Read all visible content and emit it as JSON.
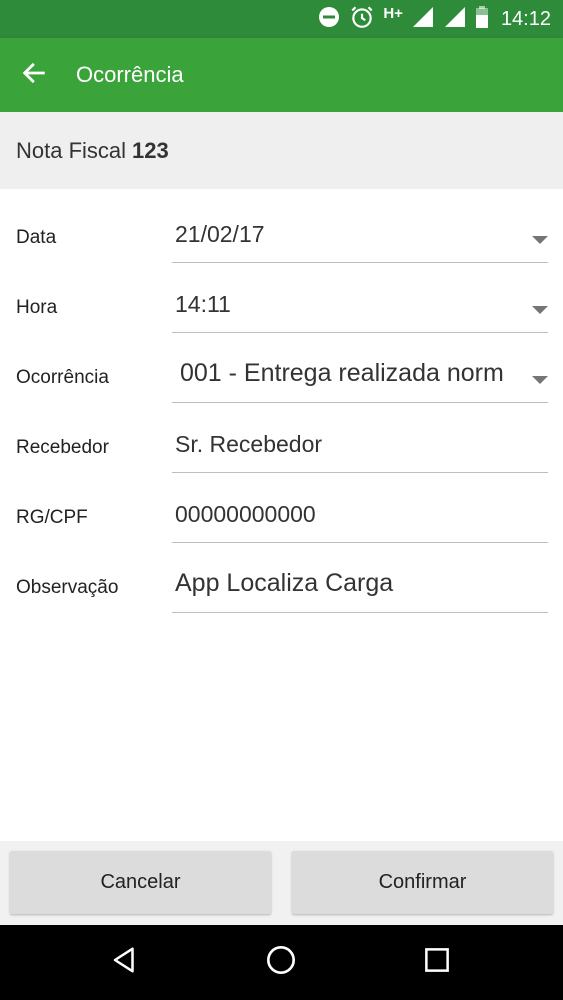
{
  "status_bar": {
    "time": "14:12",
    "network_type": "H+",
    "icons": [
      "do-not-disturb-icon",
      "alarm-icon",
      "signal-icon",
      "signal-icon",
      "battery-icon"
    ]
  },
  "app_bar": {
    "title": "Ocorrência",
    "back_icon": "arrow-back-icon"
  },
  "invoice": {
    "label": "Nota Fiscal",
    "number": "123"
  },
  "form": {
    "date": {
      "label": "Data",
      "value": "21/02/17"
    },
    "time": {
      "label": "Hora",
      "value": "14:11"
    },
    "occurrence": {
      "label": "Ocorrência",
      "value": "001 - Entrega realizada norm"
    },
    "receiver": {
      "label": "Recebedor",
      "value": "Sr. Recebedor"
    },
    "document": {
      "label": "RG/CPF",
      "value": "00000000000"
    },
    "notes": {
      "label": "Observação",
      "value": "App Localiza Carga"
    }
  },
  "actions": {
    "cancel_label": "Cancelar",
    "confirm_label": "Confirmar"
  },
  "nav_bar": {
    "icons": [
      "back-triangle-icon",
      "home-circle-icon",
      "recents-square-icon"
    ]
  },
  "colors": {
    "status_bar": "#2e8b3a",
    "app_bar": "#3aa43b",
    "header_bg": "#efefef",
    "button_bg": "#dcdcdc",
    "nav_bar": "#000000"
  }
}
